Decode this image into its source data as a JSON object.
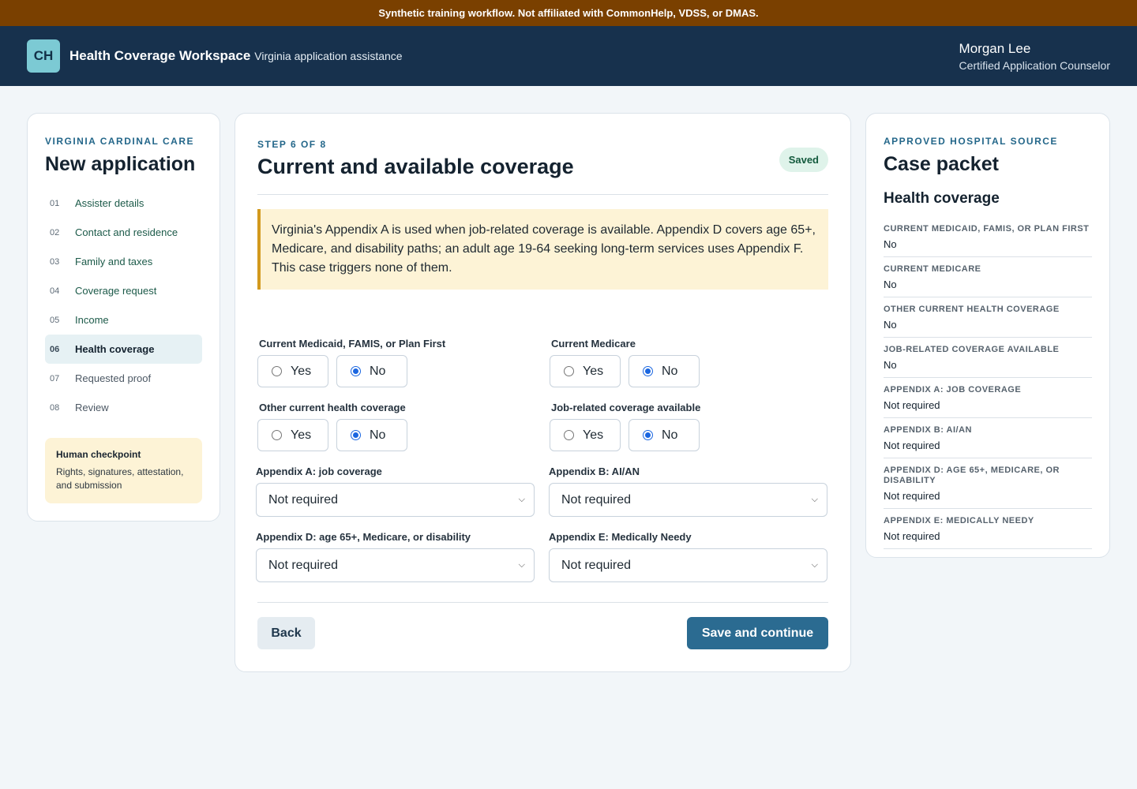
{
  "banner": "Synthetic training workflow. Not affiliated with CommonHelp, VDSS, or DMAS.",
  "header": {
    "logo": "CH",
    "title": "Health Coverage Workspace",
    "subtitle": "Virginia application assistance",
    "user_name": "Morgan Lee",
    "user_role": "Certified Application Counselor"
  },
  "sidebar": {
    "eyebrow": "Virginia Cardinal Care",
    "title": "New application",
    "steps": [
      {
        "num": "01",
        "label": "Assister details"
      },
      {
        "num": "02",
        "label": "Contact and residence"
      },
      {
        "num": "03",
        "label": "Family and taxes"
      },
      {
        "num": "04",
        "label": "Coverage request"
      },
      {
        "num": "05",
        "label": "Income"
      },
      {
        "num": "06",
        "label": "Health coverage"
      },
      {
        "num": "07",
        "label": "Requested proof"
      },
      {
        "num": "08",
        "label": "Review"
      }
    ],
    "checkpoint_title": "Human checkpoint",
    "checkpoint_text": "Rights, signatures, attestation, and submission"
  },
  "main": {
    "eyebrow": "Step 6 of 8",
    "title": "Current and available coverage",
    "status": "Saved",
    "notice": "Virginia's Appendix A is used when job-related coverage is available. Appendix D covers age 65+, Medicare, and disability paths; an adult age 19-64 seeking long-term services uses Appendix F. This case triggers none of them.",
    "yes_label": "Yes",
    "no_label": "No",
    "q_medicaid": "Current Medicaid, FAMIS, or Plan First",
    "q_medicare": "Current Medicare",
    "q_other": "Other current health coverage",
    "q_job": "Job-related coverage available",
    "s_appA_label": "Appendix A: job coverage",
    "s_appA_value": "Not required",
    "s_appB_label": "Appendix B: AI/AN",
    "s_appB_value": "Not required",
    "s_appD_label": "Appendix D: age 65+, Medicare, or disability",
    "s_appD_value": "Not required",
    "s_appE_label": "Appendix E: Medically Needy",
    "s_appE_value": "Not required",
    "back_label": "Back",
    "save_label": "Save and continue"
  },
  "packet": {
    "eyebrow": "Approved hospital source",
    "title": "Case packet",
    "section": "Health coverage",
    "rows": [
      {
        "k": "Current Medicaid, FAMIS, or Plan First",
        "v": "No"
      },
      {
        "k": "Current Medicare",
        "v": "No"
      },
      {
        "k": "Other current health coverage",
        "v": "No"
      },
      {
        "k": "Job-related coverage available",
        "v": "No"
      },
      {
        "k": "Appendix A: job coverage",
        "v": "Not required"
      },
      {
        "k": "Appendix B: AI/AN",
        "v": "Not required"
      },
      {
        "k": "Appendix D: age 65+, Medicare, or disability",
        "v": "Not required"
      },
      {
        "k": "Appendix E: Medically Needy",
        "v": "Not required"
      }
    ]
  }
}
